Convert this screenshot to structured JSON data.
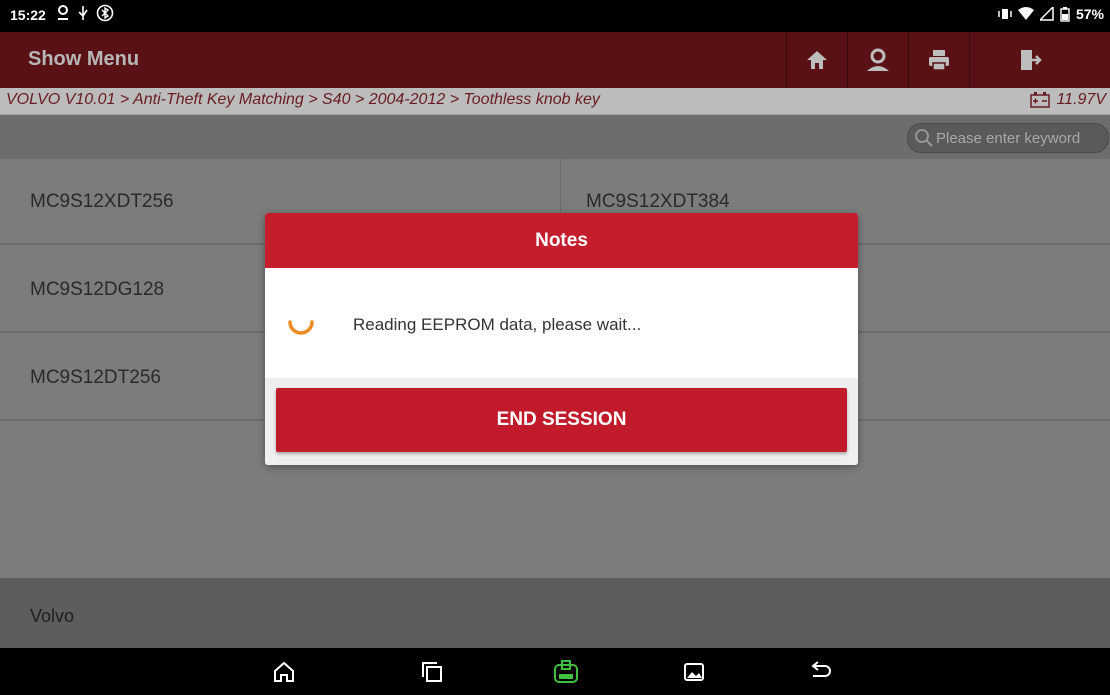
{
  "status_bar": {
    "time": "15:22",
    "battery": "57%"
  },
  "header": {
    "title": "Show Menu",
    "colors": {
      "bar": "#5a1115"
    }
  },
  "breadcrumb": {
    "path": "VOLVO V10.01 > Anti-Theft Key Matching > S40 > 2004-2012 > Toothless knob key",
    "voltage": "11.97V"
  },
  "search": {
    "placeholder": "Please enter keyword"
  },
  "list": {
    "items": [
      "MC9S12XDT256",
      "MC9S12XDT384",
      "MC9S12DG128",
      "MC9S12DT256"
    ]
  },
  "footer": {
    "brand": "Volvo"
  },
  "dialog": {
    "title": "Notes",
    "message": "Reading EEPROM data, please wait...",
    "end_button": "END SESSION",
    "colors": {
      "accent": "#c41d2c",
      "spinner": "#f08a24"
    }
  }
}
